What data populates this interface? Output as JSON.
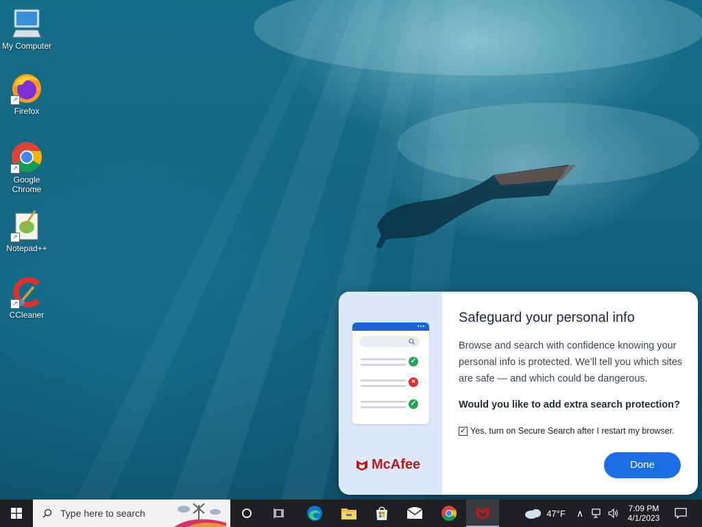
{
  "desktop": {
    "icons": [
      {
        "label": "My Computer"
      },
      {
        "label": "Firefox"
      },
      {
        "label": "Google Chrome"
      },
      {
        "label": "Notepad++"
      },
      {
        "label": "CCleaner"
      }
    ]
  },
  "popup": {
    "brand": "McAfee",
    "title": "Safeguard your personal info",
    "description": "Browse and search with confidence knowing your personal info is protected. We’ll tell you which sites are safe — and which could be dangerous.",
    "question": "Would you like to add extra search protection?",
    "checkbox_label": "Yes, turn on Secure Search after I restart my browser.",
    "checkbox_checked": true,
    "done_label": "Done",
    "colors": {
      "accent": "#1b6fe3",
      "brand": "#c01818",
      "safe": "#1fa84f",
      "danger": "#e0302a"
    }
  },
  "taskbar": {
    "search_placeholder": "Type here to search",
    "weather": "47°F",
    "time": "7:09 PM",
    "date": "4/1/2023",
    "pinned": [
      "cortana-icon",
      "task-view-icon",
      "edge-icon",
      "file-explorer-icon",
      "store-icon",
      "mail-icon",
      "chrome-icon",
      "mcafee-icon"
    ]
  }
}
